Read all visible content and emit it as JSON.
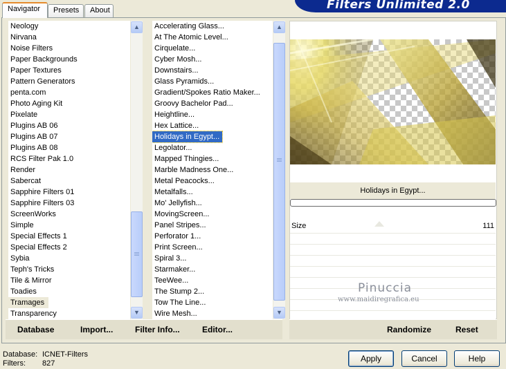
{
  "tabs": [
    "Navigator",
    "Presets",
    "About"
  ],
  "banner_title": "Filters Unlimited 2.0",
  "categories": [
    "Neology",
    "Nirvana",
    "Noise Filters",
    "Paper Backgrounds",
    "Paper Textures",
    "Pattern Generators",
    "penta.com",
    "Photo Aging Kit",
    "Pixelate",
    "Plugins AB 06",
    "Plugins AB 07",
    "Plugins AB 08",
    "RCS Filter Pak 1.0",
    "Render",
    "Sabercat",
    "Sapphire Filters 01",
    "Sapphire Filters 03",
    "ScreenWorks",
    "Simple",
    "Special Effects 1",
    "Special Effects 2",
    "Sybia",
    "Teph's Tricks",
    "Tile & Mirror",
    "Toadies",
    "Tramages",
    "Transparency"
  ],
  "selected_category": "Tramages",
  "filters": [
    "Accelerating Glass...",
    "At The Atomic Level...",
    "Cirquelate...",
    "Cyber Mosh...",
    "Downstairs...",
    "Glass Pyramids...",
    "Gradient/Spokes Ratio Maker...",
    "Groovy Bachelor Pad...",
    "Heightline...",
    "Hex Lattice...",
    "Holidays in Egypt...",
    "Legolator...",
    "Mapped Thingies...",
    "Marble Madness One...",
    "Metal Peacocks...",
    "Metalfalls...",
    "Mo' Jellyfish...",
    "MovingScreen...",
    "Panel Stripes...",
    "Perforator 1...",
    "Print Screen...",
    "Spiral 3...",
    "Starmaker...",
    "TeeWee...",
    "The Stump 2...",
    "Tow The Line...",
    "Wire Mesh..."
  ],
  "selected_filter": "Holidays in Egypt...",
  "preview_title": "Holidays in Egypt...",
  "param": {
    "label": "Size",
    "value": "111"
  },
  "watermark": {
    "name": "Pinuccia",
    "url": "www.maidiregrafica.eu"
  },
  "toolbar": {
    "database": "Database",
    "import": "Import...",
    "filter_info": "Filter Info...",
    "editor": "Editor...",
    "randomize": "Randomize",
    "reset": "Reset"
  },
  "status": {
    "database_label": "Database:",
    "database_value": "ICNET-Filters",
    "filters_label": "Filters:",
    "filters_value": "827"
  },
  "buttons": {
    "apply": "Apply",
    "cancel": "Cancel",
    "help": "Help"
  }
}
